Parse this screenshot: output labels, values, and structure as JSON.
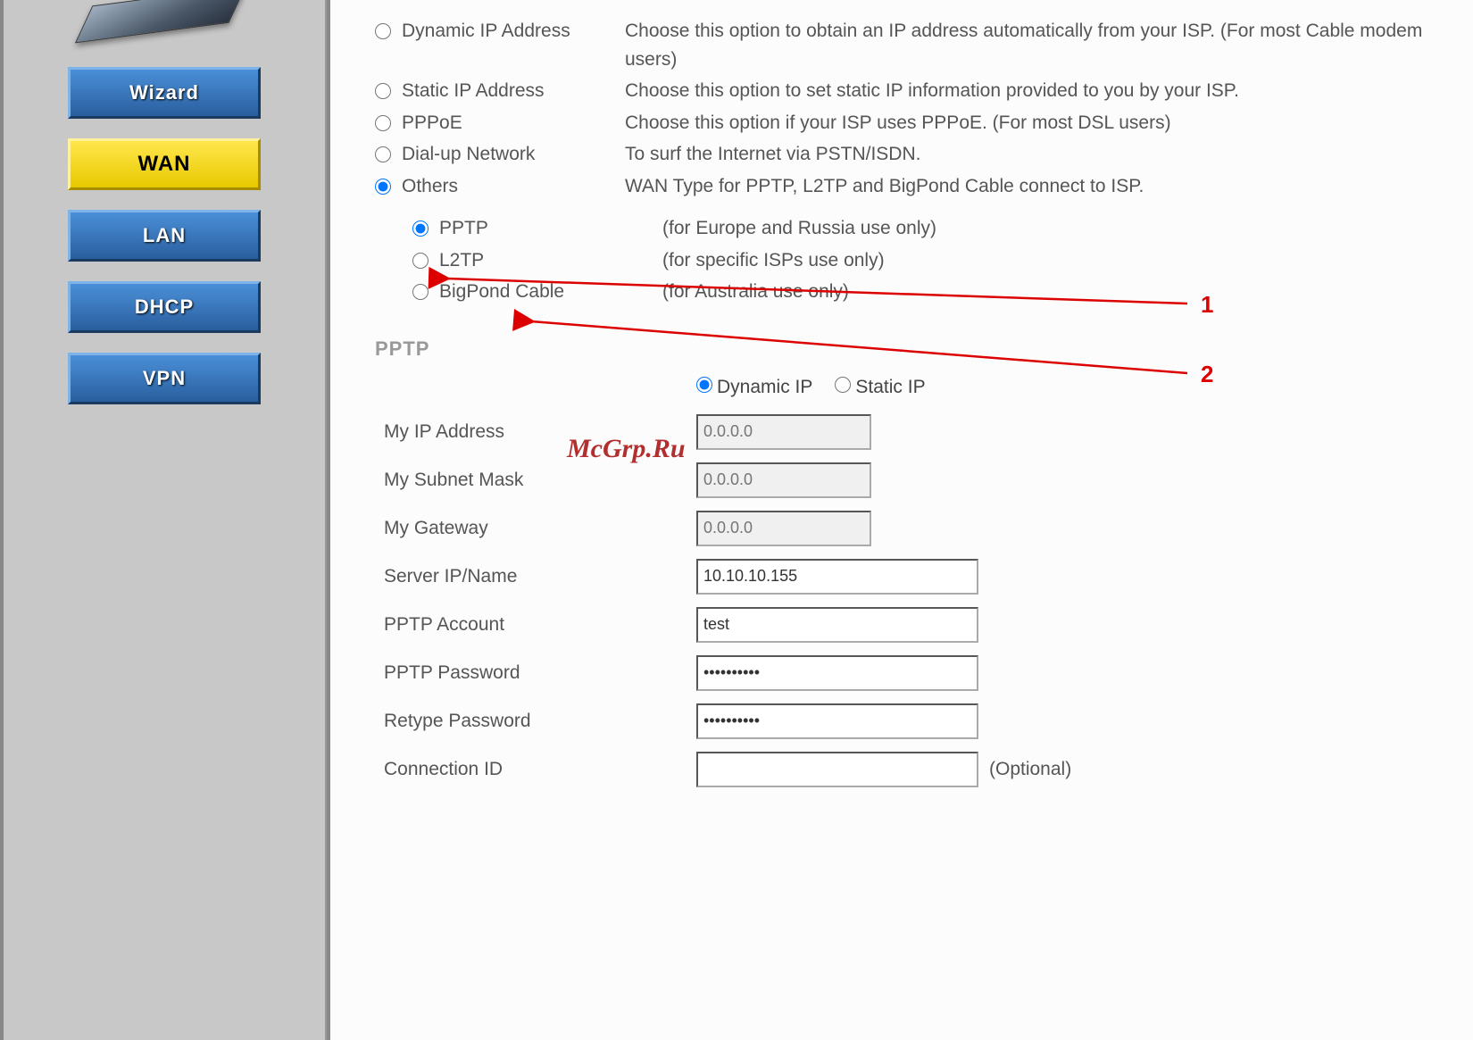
{
  "sidebar": {
    "items": [
      {
        "label": "Wizard",
        "active": false
      },
      {
        "label": "WAN",
        "active": true
      },
      {
        "label": "LAN",
        "active": false
      },
      {
        "label": "DHCP",
        "active": false
      },
      {
        "label": "VPN",
        "active": false
      }
    ]
  },
  "wan_types": [
    {
      "label": "Dynamic IP Address",
      "desc": "Choose this option to obtain an IP address automatically from your ISP. (For most Cable modem users)",
      "checked": false
    },
    {
      "label": "Static IP Address",
      "desc": "Choose this option to set static IP information provided to you by your ISP.",
      "checked": false
    },
    {
      "label": "PPPoE",
      "desc": "Choose this option if your ISP uses PPPoE. (For most DSL users)",
      "checked": false
    },
    {
      "label": "Dial-up Network",
      "desc": "To surf the Internet via PSTN/ISDN.",
      "checked": false
    },
    {
      "label": "Others",
      "desc": "WAN Type for PPTP, L2TP and BigPond Cable connect to ISP.",
      "checked": true
    }
  ],
  "sub_types": [
    {
      "label": "PPTP",
      "desc": "(for Europe and Russia use only)",
      "checked": true
    },
    {
      "label": "L2TP",
      "desc": "(for specific ISPs use only)",
      "checked": false
    },
    {
      "label": "BigPond Cable",
      "desc": "(for Australia use only)",
      "checked": false
    }
  ],
  "pptp": {
    "section": "PPTP",
    "ip_mode": {
      "dynamic_label": "Dynamic IP",
      "static_label": "Static IP",
      "selected": "dynamic"
    },
    "fields": {
      "my_ip_label": "My IP Address",
      "my_ip_placeholder": "0.0.0.0",
      "my_subnet_label": "My Subnet Mask",
      "my_subnet_placeholder": "0.0.0.0",
      "my_gateway_label": "My Gateway",
      "my_gateway_placeholder": "0.0.0.0",
      "server_label": "Server IP/Name",
      "server_value": "10.10.10.155",
      "account_label": "PPTP Account",
      "account_value": "test",
      "password_label": "PPTP Password",
      "password_value": "••••••••••",
      "retype_label": "Retype Password",
      "retype_value": "••••••••••",
      "conn_id_label": "Connection ID",
      "conn_id_value": "",
      "optional_text": "(Optional)"
    }
  },
  "annotations": {
    "num1": "1",
    "num2": "2",
    "watermark": "McGrp.Ru"
  }
}
